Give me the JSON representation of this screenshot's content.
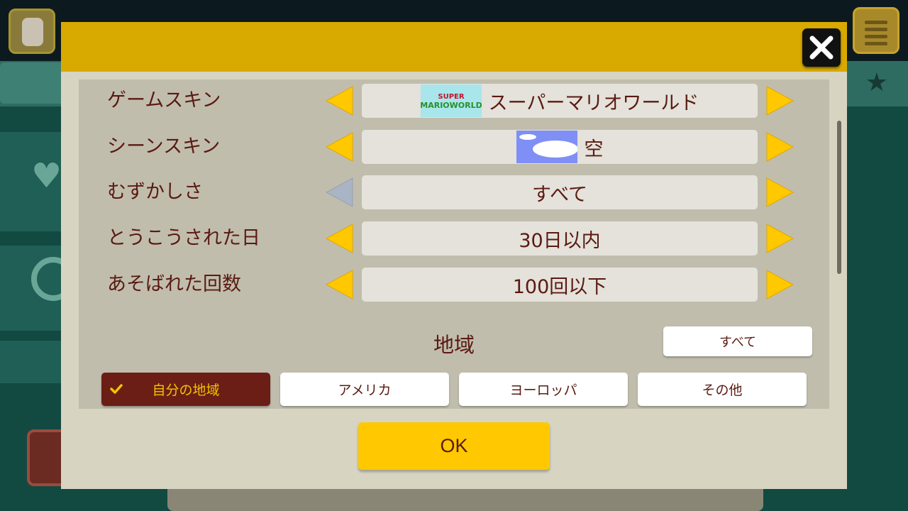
{
  "dialog": {
    "close_icon": "close-x-icon"
  },
  "filters": [
    {
      "label": "ゲームスキン",
      "value": "スーパーマリオワールド",
      "left_enabled": true,
      "right_enabled": true,
      "thumb_text": "SUPER MARIO WORLD"
    },
    {
      "label": "シーンスキン",
      "value": "空",
      "left_enabled": true,
      "right_enabled": true
    },
    {
      "label": "むずかしさ",
      "value": "すべて",
      "left_enabled": false,
      "right_enabled": true
    },
    {
      "label": "とうこうされた日",
      "value": "30日以内",
      "left_enabled": true,
      "right_enabled": true
    },
    {
      "label": "あそばれた回数",
      "value": "100回以下",
      "left_enabled": true,
      "right_enabled": true
    }
  ],
  "region": {
    "title": "地域",
    "all_label": "すべて",
    "options": [
      {
        "label": "自分の地域",
        "selected": true
      },
      {
        "label": "アメリカ",
        "selected": false
      },
      {
        "label": "ヨーロッパ",
        "selected": false
      },
      {
        "label": "その他",
        "selected": false
      }
    ]
  },
  "ok_label": "OK",
  "colors": {
    "header_yellow": "#d8aa00",
    "arrow_yellow": "#ffc800",
    "arrow_disabled": "#a9b4c4",
    "text_brown": "#5a1a12",
    "selected_bg": "#6b1e16",
    "selected_text": "#f0c400",
    "sky_blue": "#7f8ff5"
  }
}
